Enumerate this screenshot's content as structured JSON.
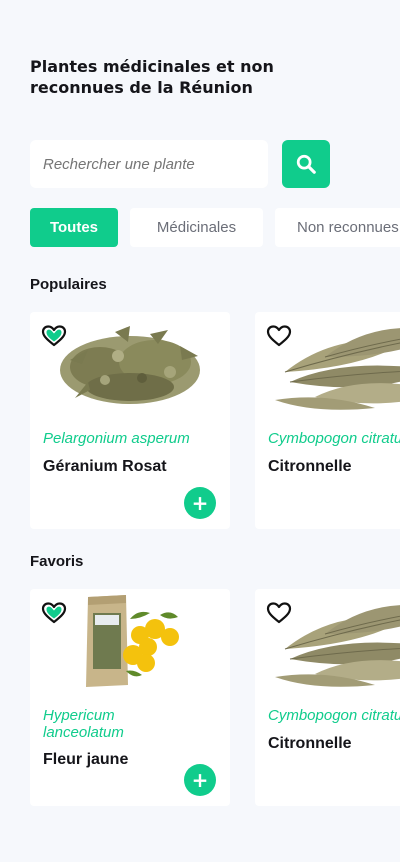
{
  "header": {
    "title": "Plantes médicinales et non reconnues de la Réunion"
  },
  "search": {
    "placeholder": "Rechercher une plante",
    "icon": "search-icon"
  },
  "filters": [
    {
      "label": "Toutes",
      "active": true
    },
    {
      "label": "Médicinales",
      "active": false
    },
    {
      "label": "Non reconnues",
      "active": false
    }
  ],
  "sections": {
    "popular": {
      "title": "Populaires",
      "cards": [
        {
          "scientific": "Pelargonium asperum",
          "name": "Géranium Rosat",
          "favorite": true,
          "image": "dried-leaves"
        },
        {
          "scientific": "Cymbopogon citratus",
          "name": "Citronnelle",
          "favorite": false,
          "image": "bay-leaves"
        }
      ]
    },
    "favorites": {
      "title": "Favoris",
      "cards": [
        {
          "scientific": "Hypericum lanceolatum",
          "name": "Fleur jaune",
          "favorite": true,
          "image": "tea-bag-yellow-flower"
        },
        {
          "scientific": "Cymbopogon citratus",
          "name": "Citronnelle",
          "favorite": false,
          "image": "bay-leaves"
        }
      ]
    }
  },
  "colors": {
    "accent": "#10cc8c",
    "background": "#f6f8fc",
    "text": "#15151a"
  },
  "add_label": "+"
}
